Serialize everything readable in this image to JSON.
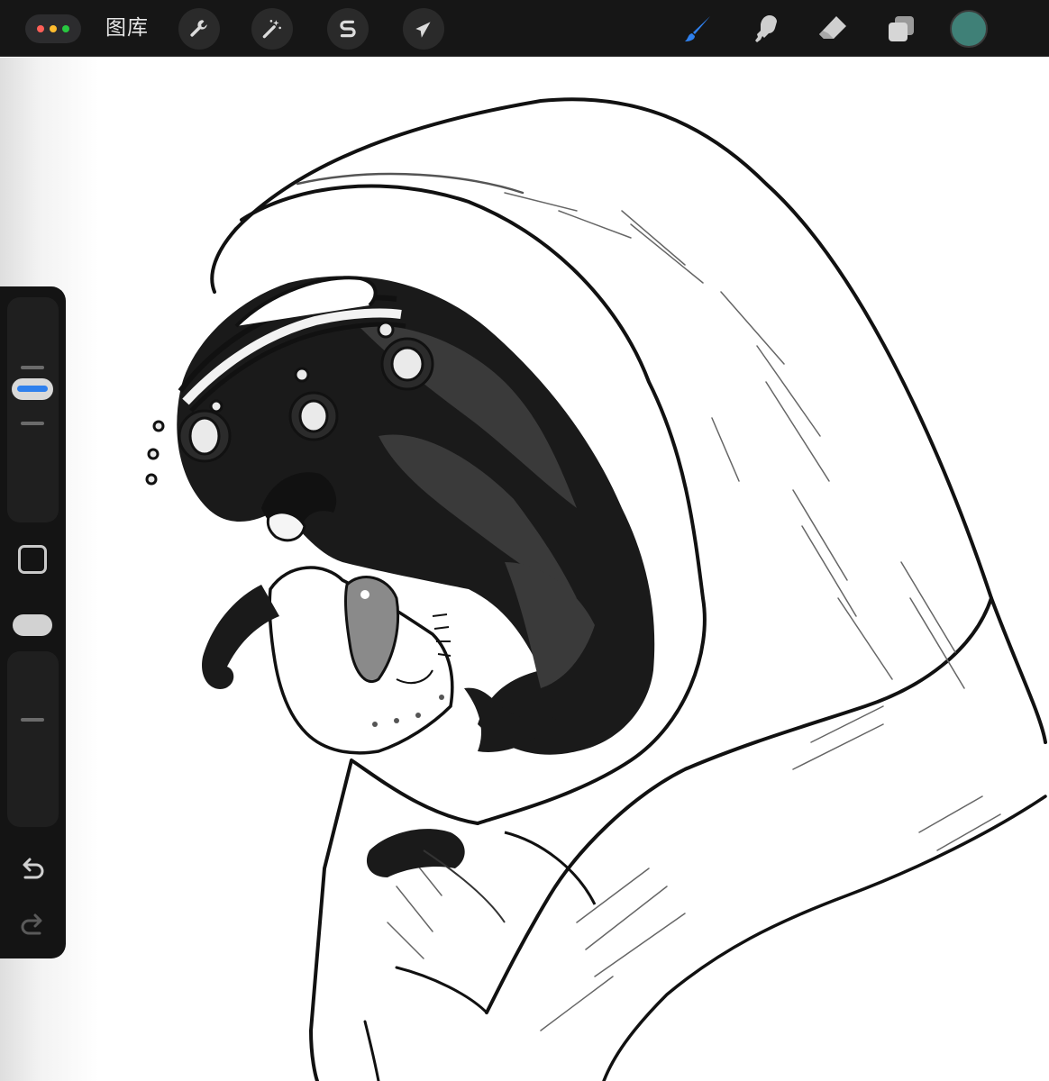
{
  "app": {
    "gallery_label": "图库",
    "window_dots": [
      "#ff5f57",
      "#febc2e",
      "#28c840"
    ]
  },
  "toolbar": {
    "actions": [
      {
        "id": "actions",
        "icon": "wrench-icon"
      },
      {
        "id": "adjustments",
        "icon": "magic-wand-icon"
      },
      {
        "id": "selection",
        "icon": "selection-s-icon"
      },
      {
        "id": "transform",
        "icon": "arrow-cursor-icon"
      }
    ],
    "tools": [
      {
        "id": "brush",
        "icon": "paintbrush-icon",
        "active": true
      },
      {
        "id": "smudge",
        "icon": "smudge-finger-icon",
        "active": false
      },
      {
        "id": "eraser",
        "icon": "eraser-icon",
        "active": false
      },
      {
        "id": "layers",
        "icon": "layers-icon",
        "active": false
      }
    ],
    "current_color": "#3f8077",
    "active_tool_color": "#2f80ed"
  },
  "sidebar": {
    "brush_size_icon": "size-slider",
    "modify_button_icon": "square-icon",
    "opacity_icon": "opacity-slider",
    "undo_icon": "undo-icon",
    "redo_icon": "redo-icon"
  }
}
